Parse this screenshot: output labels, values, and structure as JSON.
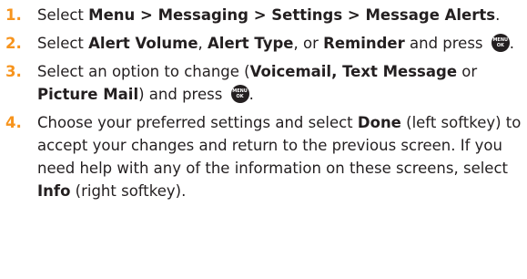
{
  "steps": [
    {
      "num": "1.",
      "parts": [
        "Select ",
        "Menu > Messaging > Settings > Message Alerts",
        "."
      ]
    },
    {
      "num": "2.",
      "parts": [
        "Select ",
        "Alert Volume",
        ", ",
        "Alert Type",
        ", or ",
        "Reminder",
        " and press ",
        "."
      ]
    },
    {
      "num": "3.",
      "parts": [
        "Select an option to change (",
        "Voicemail, Text Message",
        " or ",
        "Picture Mail",
        ") and press ",
        "."
      ]
    },
    {
      "num": "4.",
      "parts": [
        "Choose your preferred settings and select ",
        "Done",
        " (left softkey) to accept your changes and return to the previous screen. If you need help with any of the information on these screens, select ",
        "Info",
        " (right softkey)."
      ]
    }
  ],
  "menu_key": {
    "icon": "menu-ok-key-icon",
    "line1": "MENU",
    "line2": "OK"
  },
  "colors": {
    "step_number": "#f7941d",
    "text": "#231f20"
  }
}
